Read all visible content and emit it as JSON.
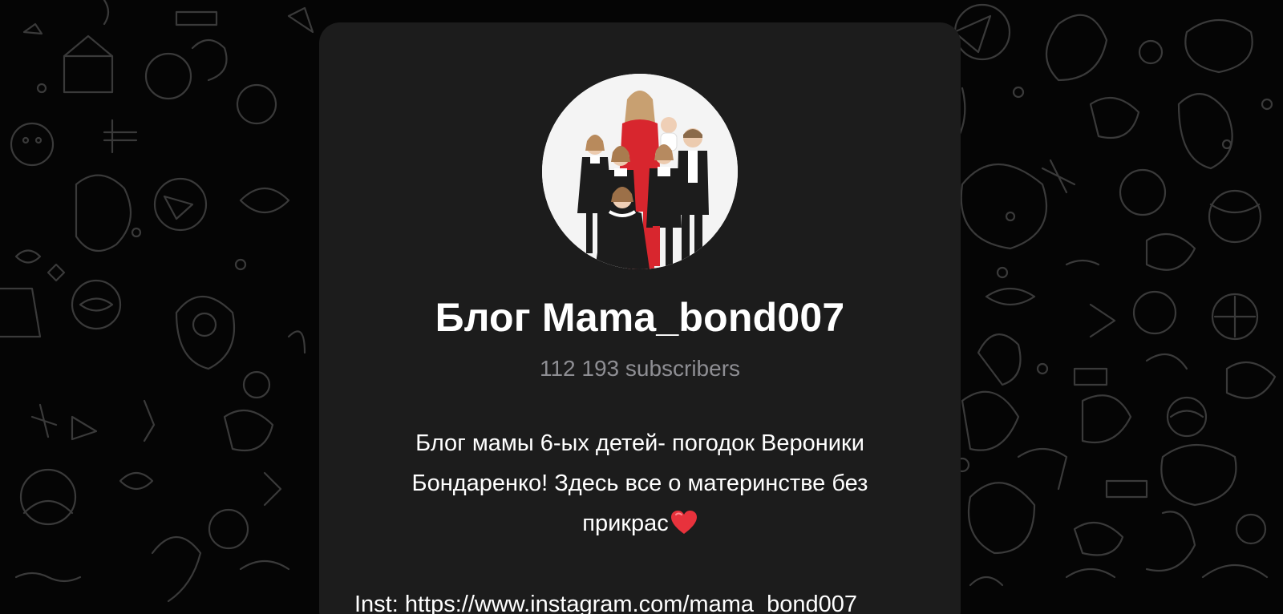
{
  "channel": {
    "title": "Блог Mama_bond007",
    "subscribers": "112 193 subscribers",
    "description": {
      "line1": "Блог мамы 6-ых детей- погодок Вероники",
      "line2": "Бондаренко! Здесь все о материнстве без",
      "line3": "прикрас",
      "emoji": "heart-emoji"
    },
    "link_text": "Inst: https://www.instagram.com/mama_bond007"
  },
  "colors": {
    "background": "#050505",
    "card": "#1c1c1c",
    "text": "#ffffff",
    "muted": "#8e8e93",
    "heart": "#e8323c",
    "doodle": "#3a3a3a"
  },
  "icons": {
    "avatar": "channel-avatar-photo",
    "background": "telegram-doodle-pattern"
  }
}
